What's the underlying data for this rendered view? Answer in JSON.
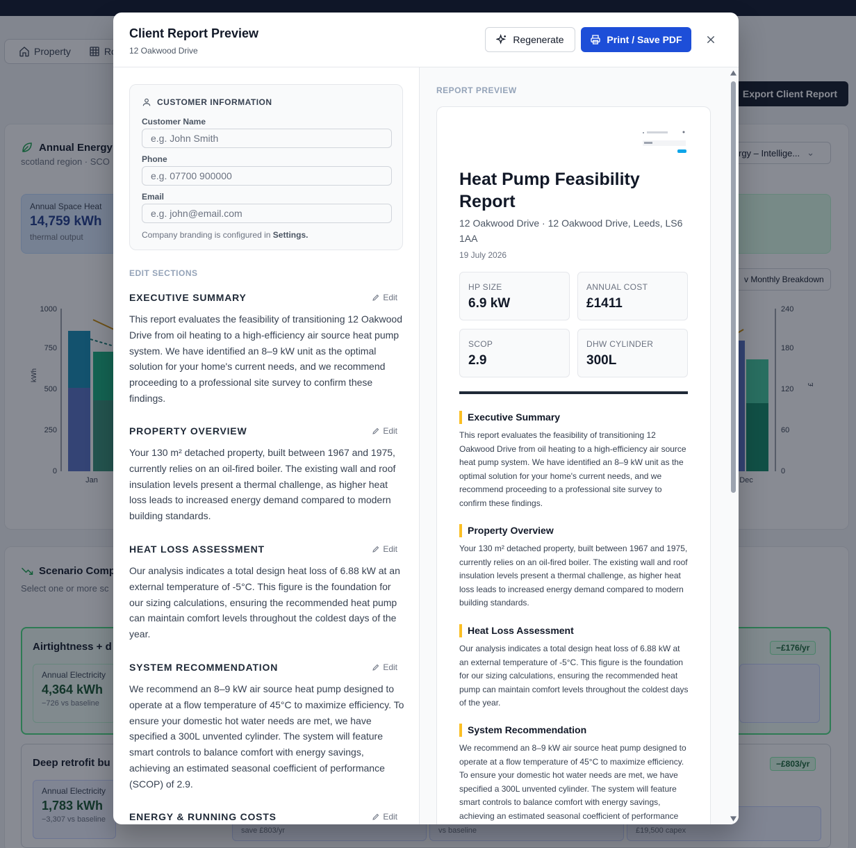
{
  "background": {
    "tabs": [
      {
        "label": "Property"
      },
      {
        "label": "Ro"
      }
    ],
    "export_button": "Export Client Report",
    "energy_card": {
      "title": "Annual Energy",
      "subtitle": "scotland region · SCO",
      "stat": {
        "label": "Annual Space Heat",
        "value": "14,759 kWh",
        "sub": "thermal output"
      },
      "select_value": "rgy – Intellige...",
      "monthly_button": "v Monthly Breakdown",
      "chart": {
        "y_left_ticks": [
          "1000",
          "750",
          "500",
          "250",
          "0"
        ],
        "y_left_label": "kWh",
        "y_right_ticks": [
          "240",
          "180",
          "120",
          "60",
          "0"
        ],
        "y_right_label": "£",
        "x_ticks": [
          "Jan",
          "Dec"
        ]
      }
    },
    "scenario_card": {
      "title": "Scenario Comp",
      "subtitle": "Select one or more sc",
      "scenarios": [
        {
          "title": "Airtightness + d",
          "badge": "−£176/yr",
          "metric_label": "Annual Electricity",
          "metric_value": "4,364 kWh",
          "metric_sub": "−726 vs baseline"
        },
        {
          "title": "Deep retrofit bu",
          "badge": "−£803/yr",
          "metric_label": "Annual Electricity",
          "metric_value": "1,783 kWh",
          "metric_sub": "−3,307 vs baseline",
          "extra_subs": [
            "save £803/yr",
            "vs baseline",
            "£19,500 capex"
          ]
        }
      ]
    }
  },
  "modal": {
    "title": "Client Report Preview",
    "subtitle": "12 Oakwood Drive",
    "regenerate_label": "Regenerate",
    "print_label": "Print / Save PDF",
    "customer": {
      "heading": "CUSTOMER INFORMATION",
      "name_label": "Customer Name",
      "name_placeholder": "e.g. John Smith",
      "phone_label": "Phone",
      "phone_placeholder": "e.g. 07700 900000",
      "email_label": "Email",
      "email_placeholder": "e.g. john@email.com",
      "branding_note": "Company branding is configured in",
      "branding_link": "Settings."
    },
    "edit_sections_label": "EDIT SECTIONS",
    "edit_label": "Edit",
    "sections": [
      {
        "title": "EXECUTIVE SUMMARY",
        "body": "This report evaluates the feasibility of transitioning 12 Oakwood Drive from oil heating to a high-efficiency air source heat pump system. We have identified an 8–9 kW unit as the optimal solution for your home's current needs, and we recommend proceeding to a professional site survey to confirm these findings."
      },
      {
        "title": "PROPERTY OVERVIEW",
        "body": "Your 130 m² detached property, built between 1967 and 1975, currently relies on an oil-fired boiler. The existing wall and roof insulation levels present a thermal challenge, as higher heat loss leads to increased energy demand compared to modern building standards."
      },
      {
        "title": "HEAT LOSS ASSESSMENT",
        "body": "Our analysis indicates a total design heat loss of 6.88 kW at an external temperature of -5°C. This figure is the foundation for our sizing calculations, ensuring the recommended heat pump can maintain comfort levels throughout the coldest days of the year."
      },
      {
        "title": "SYSTEM RECOMMENDATION",
        "body": "We recommend an 8–9 kW air source heat pump designed to operate at a flow temperature of 45°C to maximize efficiency. To ensure your domestic hot water needs are met, we have specified a 300L unvented cylinder. The system will feature smart controls to balance comfort with energy savings, achieving an estimated seasonal coefficient of performance (SCOP) of 2.9."
      },
      {
        "title": "ENERGY & RUNNING COSTS",
        "body": ""
      }
    ],
    "preview": {
      "label": "REPORT PREVIEW",
      "title": "Heat Pump Feasibility Report",
      "address": "12 Oakwood Drive · 12 Oakwood Drive, Leeds, LS6 1AA",
      "date": "19 July 2026",
      "kpis": [
        {
          "label": "HP SIZE",
          "value": "6.9 kW"
        },
        {
          "label": "ANNUAL COST",
          "value": "£1411"
        },
        {
          "label": "SCOP",
          "value": "2.9"
        },
        {
          "label": "DHW CYLINDER",
          "value": "300L"
        }
      ],
      "sections": [
        {
          "title": "Executive Summary",
          "body": "This report evaluates the feasibility of transitioning 12 Oakwood Drive from oil heating to a high-efficiency air source heat pump system. We have identified an 8–9 kW unit as the optimal solution for your home's current needs, and we recommend proceeding to a professional site survey to confirm these findings."
        },
        {
          "title": "Property Overview",
          "body": "Your 130 m² detached property, built between 1967 and 1975, currently relies on an oil-fired boiler. The existing wall and roof insulation levels present a thermal challenge, as higher heat loss leads to increased energy demand compared to modern building standards."
        },
        {
          "title": "Heat Loss Assessment",
          "body": "Our analysis indicates a total design heat loss of 6.88 kW at an external temperature of -5°C. This figure is the foundation for our sizing calculations, ensuring the recommended heat pump can maintain comfort levels throughout the coldest days of the year."
        },
        {
          "title": "System Recommendation",
          "body": "We recommend an 8–9 kW air source heat pump designed to operate at a flow temperature of 45°C to maximize efficiency. To ensure your domestic hot water needs are met, we have specified a 300L unvented cylinder. The system will feature smart controls to balance comfort with energy savings, achieving an estimated seasonal coefficient of performance"
        }
      ]
    }
  },
  "colors": {
    "primary": "#1d4ed8",
    "accent_bar": "#fbbf24",
    "success": "#4ade80"
  }
}
